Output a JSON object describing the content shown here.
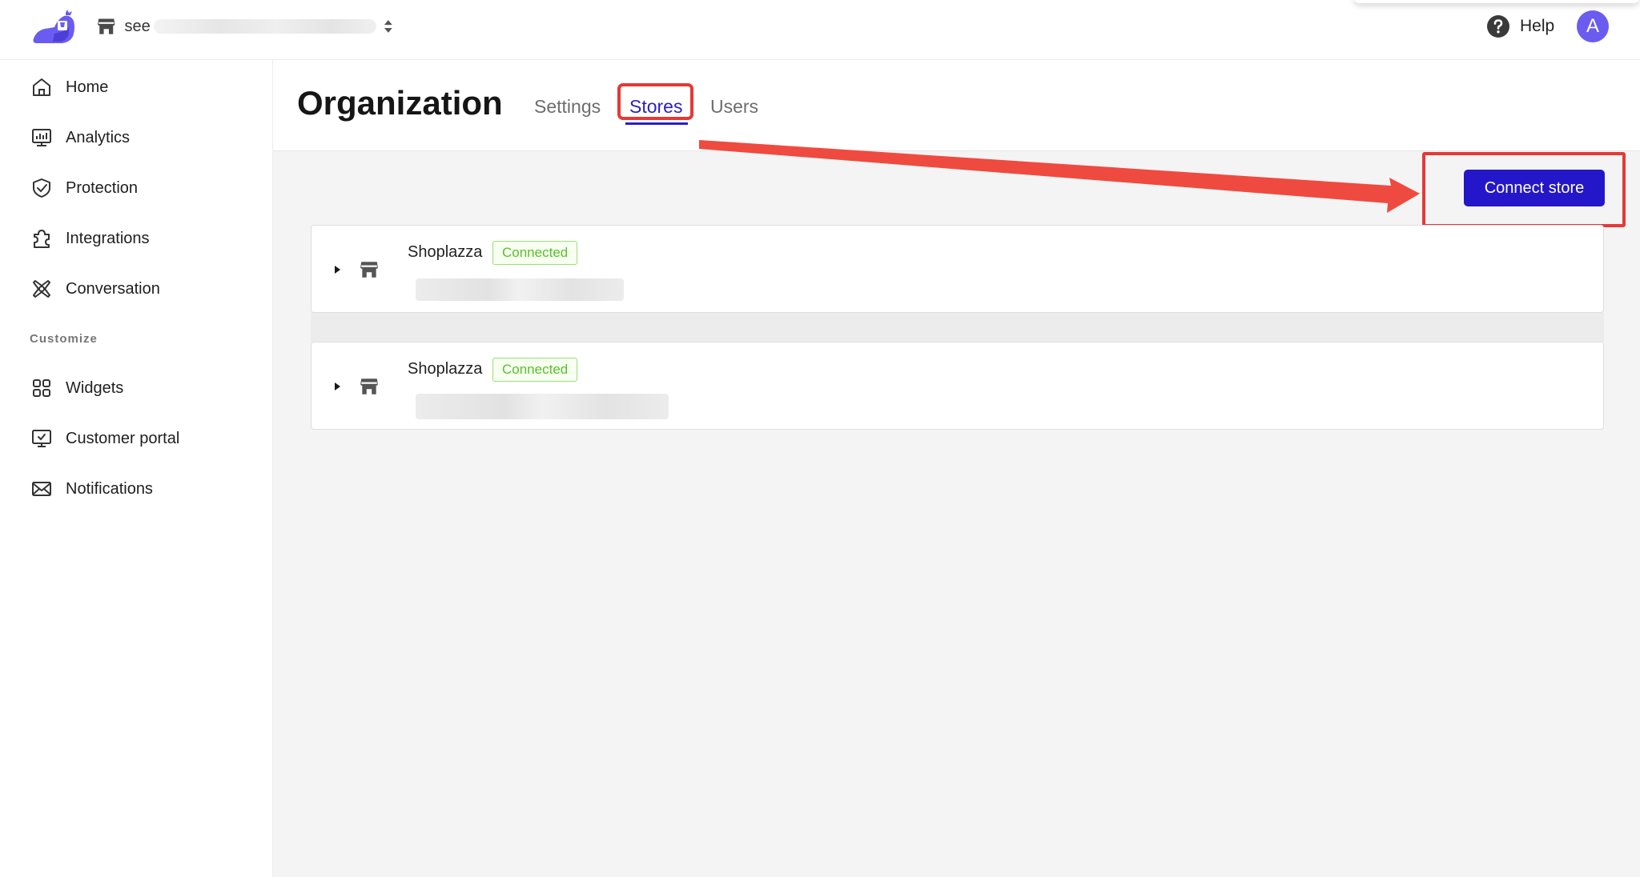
{
  "topbar": {
    "store_name": "see",
    "help_label": "Help",
    "avatar_initial": "A"
  },
  "sidebar": {
    "items": [
      {
        "label": "Home",
        "icon": "home-icon"
      },
      {
        "label": "Analytics",
        "icon": "analytics-icon"
      },
      {
        "label": "Protection",
        "icon": "shield-check-icon"
      },
      {
        "label": "Integrations",
        "icon": "puzzle-icon"
      },
      {
        "label": "Conversation",
        "icon": "conversation-icon"
      }
    ],
    "section_label": "Customize",
    "customize_items": [
      {
        "label": "Widgets",
        "icon": "widgets-icon"
      },
      {
        "label": "Customer portal",
        "icon": "monitor-icon"
      },
      {
        "label": "Notifications",
        "icon": "mail-icon"
      }
    ]
  },
  "header": {
    "title": "Organization",
    "tabs": [
      {
        "label": "Settings",
        "active": false
      },
      {
        "label": "Stores",
        "active": true
      },
      {
        "label": "Users",
        "active": false
      }
    ]
  },
  "main": {
    "connect_button_label": "Connect store",
    "stores": [
      {
        "name": "Shoplazza",
        "status": "Connected"
      },
      {
        "name": "Shoplazza",
        "status": "Connected"
      }
    ]
  },
  "colors": {
    "accent": "#2417c9",
    "annotation": "#e53935",
    "connected_green": "#5abf2a",
    "avatar": "#6a5cf0"
  }
}
